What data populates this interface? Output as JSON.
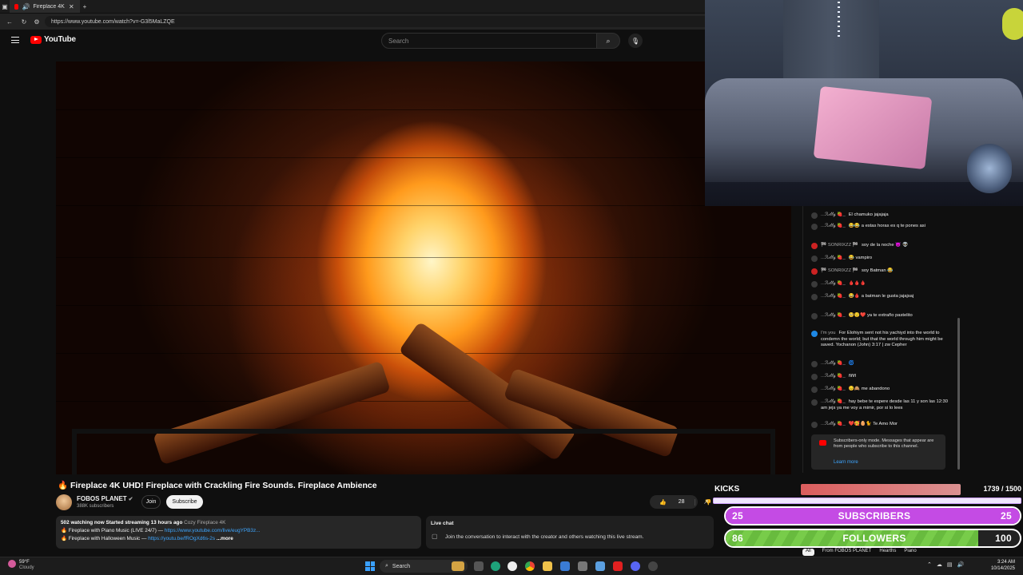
{
  "browser": {
    "tab_title": "Fireplace 4K UHD! Firepl...",
    "url": "https://www.youtube.com/watch?v=-G3l5MaLZQE"
  },
  "youtube": {
    "logo_text": "YouTube",
    "search_placeholder": "Search"
  },
  "video": {
    "title": "Fireplace 4K UHD! Fireplace with Crackling Fire Sounds. Fireplace Ambience",
    "channel": "FOBOS PLANET",
    "subscribers": "388K subscribers",
    "join_label": "Join",
    "subscribe_label": "Subscribe",
    "likes": "28"
  },
  "description": {
    "meta": "502 watching now  Started streaming 13 hours ago",
    "meta_tag": "Cozy Fireplace 4K",
    "line1_text": "Fireplace with Piano Music (LIVE 24/7) —",
    "line1_link": "https://www.youtube.com/live/eugYPB3z...",
    "line2_text": "Fireplace with Halloween Music —",
    "line2_link": "https://youtu.be/fROgXd6s-2s",
    "more_label": "...more"
  },
  "livechat": {
    "title": "Live chat",
    "message": "Join the conversation to interact with the creator and others watching this live stream."
  },
  "chat": {
    "messages": [
      {
        "user": "...ℛ𝒾𝓉𝓉𝓎 🍓_",
        "text": "El chamuko jajajaja",
        "avatar": "default"
      },
      {
        "user": "...ℛ𝒾𝓉𝓉𝓎 🍓_",
        "text": "😂😂 a estas horas es q te pones asi",
        "avatar": "default"
      },
      {
        "user": "🏁 SONRIXZZ 🏁",
        "text": "soy de la noche 😈 👽",
        "avatar": "red"
      },
      {
        "user": "...ℛ𝒾𝓉𝓉𝓎 🍓_",
        "text": "😂 vampiro",
        "avatar": "default"
      },
      {
        "user": "🏁 SONRIXZZ 🏁",
        "text": "soy Batman 😂",
        "avatar": "red"
      },
      {
        "user": "...ℛ𝒾𝓉𝓉𝓎 🍓_",
        "text": "🩸🩸🩸",
        "avatar": "default"
      },
      {
        "user": "...ℛ𝒾𝓉𝓉𝓎 🍓_",
        "text": "😂🩸 a batman le gusta jajajsaj",
        "avatar": "default"
      },
      {
        "user": "...ℛ𝒾𝓉𝓉𝓎 🍓_",
        "text": "🥺😌❤️ ya te extraño pastelito",
        "avatar": "default"
      },
      {
        "user": "I'm you",
        "text": "For Elohiym sent not his yachiyd into the world to condemn the world; but that the world through him might be saved. Yochanon (John) 3:17 | zw Cepher",
        "avatar": "blue"
      },
      {
        "user": "...ℛ𝒾𝓉𝓉𝓎 🍓_",
        "text": "🌀",
        "avatar": "default"
      },
      {
        "user": "...ℛ𝒾𝓉𝓉𝓎 🍓_",
        "text": "ñññ",
        "avatar": "default"
      },
      {
        "user": "...ℛ𝒾𝓉𝓉𝓎 🍓_",
        "text": "😔🙈 me abandono",
        "avatar": "default"
      },
      {
        "user": "...ℛ𝒾𝓉𝓉𝓎 🍓_",
        "text": "hay bebe te espere desde las 11 y son las 12:30 am jejs ya me voy a mimir, por si lo lees",
        "avatar": "default"
      },
      {
        "user": "...ℛ𝒾𝓉𝓉𝓎 🍓_",
        "text": "❤️🥰🥚🐈 Te Amo Mor",
        "avatar": "default"
      }
    ],
    "notice": "Subscribers-only mode. Messages that appear are from people who subscribe to this channel.",
    "learn_more": "Learn more"
  },
  "overlay": {
    "kicks_label": "KICKS",
    "kicks_count": "1739  / 1500",
    "kicks_progress": 1.0,
    "subs_left": "25",
    "subs_label": "SUBSCRIBERS",
    "subs_right": "25",
    "subs_progress": 1.0,
    "follow_left": "86",
    "follow_label": "FOLLOWERS",
    "follow_right": "100",
    "follow_progress": 0.86
  },
  "chips": [
    "All",
    "From FOBOS PLANET",
    "Hearths",
    "Piano"
  ],
  "taskbar": {
    "weather_temp": "59°F",
    "weather_cond": "Cloudy",
    "search_label": "Search",
    "time": "3:24 AM",
    "date": "10/14/2025"
  }
}
